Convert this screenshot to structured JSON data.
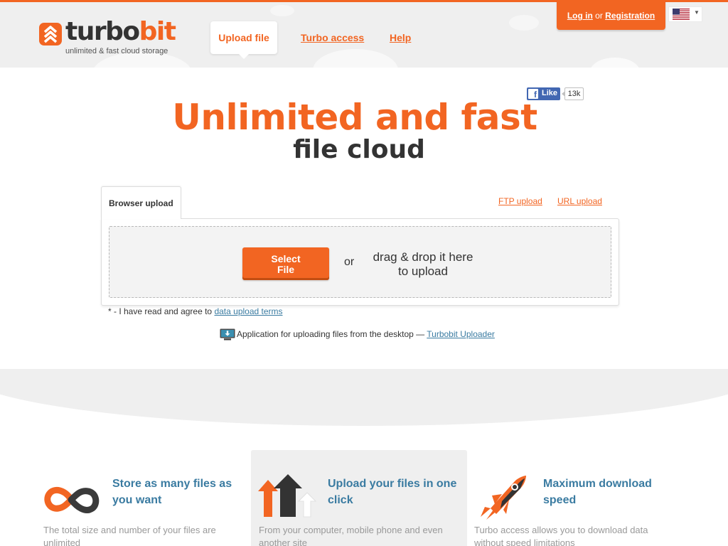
{
  "brand": {
    "name_part1": "turbo",
    "name_part2": "bit",
    "tagline": "unlimited & fast cloud storage",
    "accent_color": "#f26522",
    "link_color": "#3a7ba1"
  },
  "nav": {
    "upload_file": "Upload file",
    "turbo_access": "Turbo access",
    "help": "Help"
  },
  "auth": {
    "login": "Log in",
    "or": "or",
    "registration": "Registration"
  },
  "language": {
    "icon": "us-flag-icon"
  },
  "like": {
    "label": "Like",
    "count": "13k"
  },
  "hero": {
    "title": "Unlimited and fast",
    "subtitle": "file cloud"
  },
  "upload": {
    "tab_browser": "Browser upload",
    "tab_ftp": "FTP upload",
    "tab_url": "URL upload",
    "select_line1": "Select",
    "select_line2": "File",
    "or": "or",
    "drop_line1": "drag & drop it here",
    "drop_line2": "to upload",
    "terms_prefix": "* - I have read and agree to",
    "terms_link": "data upload terms",
    "desktop_text": "Application for uploading files from the desktop —",
    "desktop_link": "Turbobit Uploader"
  },
  "features": [
    {
      "icon": "infinity-icon",
      "title": "Store as many files as you want",
      "desc": "The total size and number of your files are unlimited"
    },
    {
      "icon": "upload-arrows-icon",
      "title": "Upload your files in one click",
      "desc": "From your computer, mobile phone and even another site"
    },
    {
      "icon": "rocket-icon",
      "title": "Maximum download speed",
      "desc": "Turbo access allows you to download data without speed limitations"
    }
  ]
}
